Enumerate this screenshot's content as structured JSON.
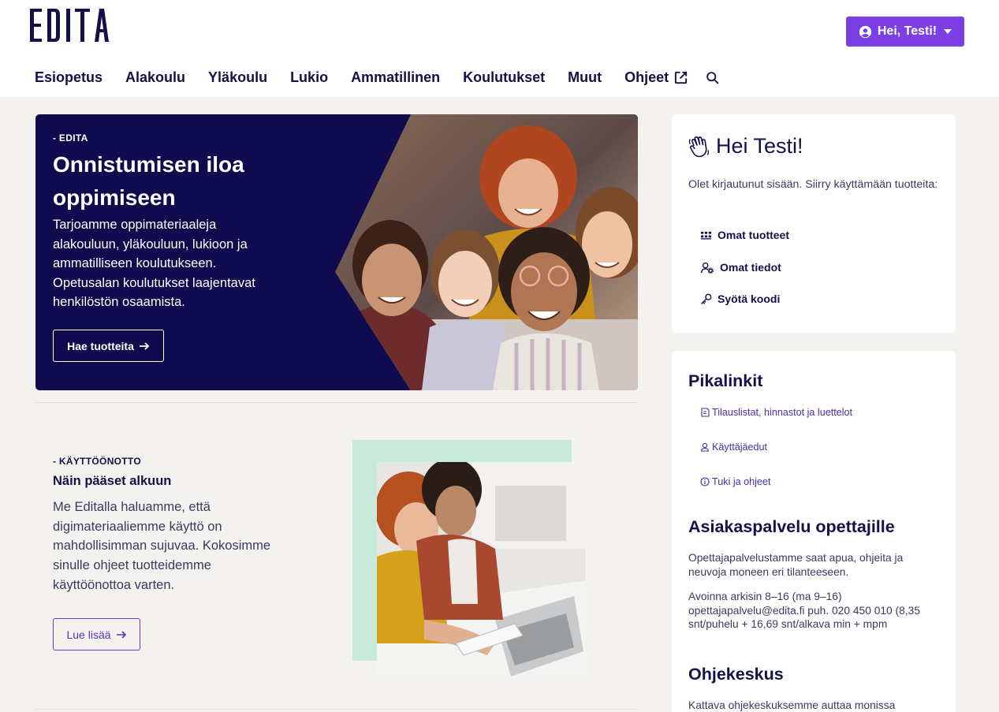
{
  "brand": {
    "logo_text": "EDITA",
    "accent": "#7b3fe4",
    "navy": "#100b4e",
    "mint": "#c9eadb"
  },
  "user_menu": {
    "label": "Hei, Testi!",
    "icon": "user-circle-icon"
  },
  "nav": {
    "items": [
      "Esiopetus",
      "Alakoulu",
      "Yläkoulu",
      "Lukio",
      "Ammatillinen",
      "Koulutukset",
      "Muut"
    ],
    "ohjeet": "Ohjeet",
    "search_icon": "search-icon"
  },
  "hero": {
    "kicker": "- EDITA",
    "title": "Onnistumisen iloa oppimiseen",
    "text": "Tarjoamme oppimateriaaleja alakouluun, yläkouluun, lukioon ja ammatilliseen koulutukseen. Opetusalan koulutukset laajentavat henkilöstön osaamista.",
    "button": "Hae tuotteita"
  },
  "intro_section": {
    "kicker": "- KÄYTTÖÖNOTTO",
    "title": "Näin pääset alkuun",
    "text": "Me Editalla haluamme, että digimateriaaliemme käyttö on mahdollisimman sujuvaa. Kokosimme sinulle ohjeet tuotteidemme käyttöönottoa varten.",
    "button": "Lue lisää"
  },
  "account_card": {
    "title": "Hei Testi!",
    "text": "Olet kirjautunut sisään. Siirry käyttämään tuotteita:",
    "links": [
      "Omat tuotteet",
      "Omat tiedot",
      "Syötä koodi"
    ]
  },
  "quicklinks_card": {
    "title": "Pikalinkit",
    "links": [
      "Tilauslistat, hinnastot ja luettelot",
      "Käyttäjäedut",
      "Tuki ja ohjeet"
    ],
    "service_title": "Asiakaspalvelu opettajille",
    "service_text": "Opettajapalvelustamme saat apua, ohjeita ja neuvoja moneen eri tilanteeseen.",
    "service_hours": "Avoinna arkisin 8–16 (ma 9–16) opettajapalvelu@edita.fi puh. 020 450 010 (8,35 snt/puhelu + 16,69 snt/alkava min + mpm",
    "help_title": "Ohjekeskus",
    "help_text": "Kattava ohjekeskuksemme auttaa monissa"
  }
}
